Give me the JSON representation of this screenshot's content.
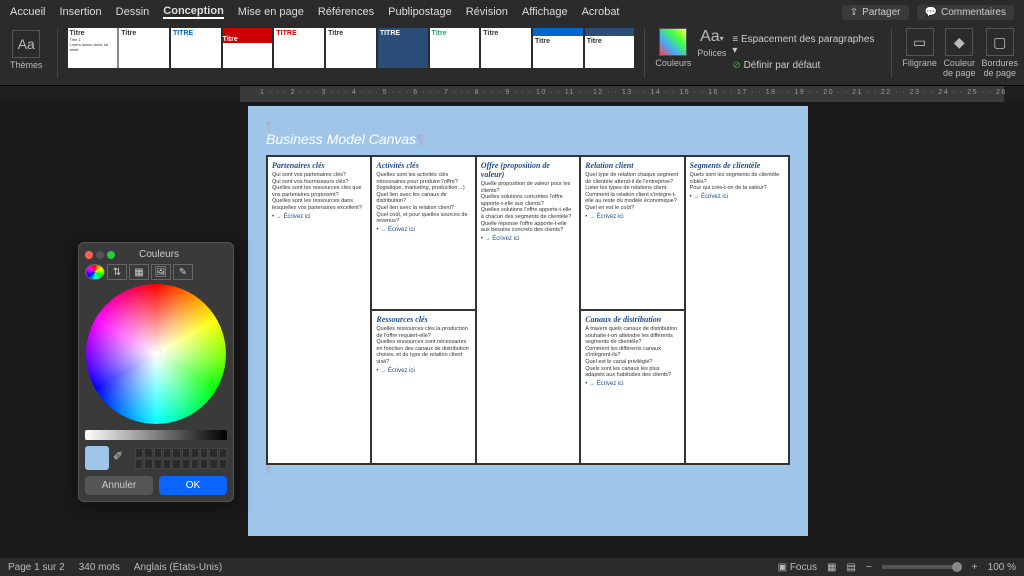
{
  "tabs": {
    "items": [
      "Accueil",
      "Insertion",
      "Dessin",
      "Conception",
      "Mise en page",
      "Références",
      "Publipostage",
      "Révision",
      "Affichage",
      "Acrobat"
    ],
    "active": "Conception",
    "share": "Partager",
    "comments": "Commentaires"
  },
  "ribbon": {
    "themes": "Thèmes",
    "colors": "Couleurs",
    "fonts": "Polices",
    "spacing": "Espacement des paragraphes",
    "default": "Définir par défaut",
    "watermark": "Filigrane",
    "pagecolor": "Couleur\nde page",
    "borders": "Bordures\nde page",
    "gallery_titles": [
      "Titre",
      "Titre",
      "TITRE",
      "Titre",
      "TITRE",
      "Titre",
      "TITRE",
      "Titre",
      "Titre",
      "Titre",
      "Titre"
    ]
  },
  "picker": {
    "title": "Couleurs",
    "cancel": "Annuler",
    "ok": "OK"
  },
  "doc": {
    "title": "Business Model Canvas",
    "write": "→ Écrivez ici",
    "cells": {
      "partners": {
        "h": "Partenaires clés",
        "q": "Qui sont vos partenaires clés?\nQui sont vos fournisseurs clés?\nQuelles sont les ressources clés que vos partenaires proposent?\nQuelles sont les ressources dans lesquelles vos partenaires excellent?"
      },
      "activities": {
        "h": "Activités clés",
        "q": "Quelles sont les activités clés nécessaires pour produire l'offre? (logistique, marketing, production…)\nQuel lien avec les canaux de distribution?\nQuel lien avec la relation client?\nQuel coût, et pour quelles sources de revenus?"
      },
      "resources": {
        "h": "Ressources clés",
        "q": "Quelles ressources clés la production de l'offre requiert-elle?\nQuelles ressources sont nécessaires en fonction des canaux de distribution choisis, et du type de relation client visé?"
      },
      "value": {
        "h": "Offre (proposition de valeur)",
        "q": "Quelle proposition de valeur pour les clients?\nQuelles solutions concrètes l'offre apporte-t-elle aux clients?\nQuelles solutions l'offre apporte-t-elle à chacun des segments de clientèle?\nQuelle réponse l'offre apporte-t-elle aux besoins concrets des clients?"
      },
      "relation": {
        "h": "Relation client",
        "q": "Quel type de relation chaque segment de clientèle attend-il de l'entreprise?\nLister les types de relations client.\nComment la relation client s'intègre-t-elle au reste du modèle économique?\nQuel en est le coût?"
      },
      "channels": {
        "h": "Canaux de distribution",
        "q": "À travers quels canaux de distribution souhaite-t-on atteindre les différents segments de clientèle?\nComment les différents canaux s'intègrent-ils?\nQuel est le canal privilégié?\nQuels sont les canaux les plus adaptés aux habitudes des clients?"
      },
      "segments": {
        "h": "Segments de clientèle",
        "q": "Quels sont les segments de clientèle ciblés?\nPour qui crée-t-on de la valeur?"
      }
    }
  },
  "status": {
    "page": "Page 1 sur 2",
    "words": "340 mots",
    "lang": "Anglais (États-Unis)",
    "focus": "Focus",
    "zoom": "100 %"
  }
}
